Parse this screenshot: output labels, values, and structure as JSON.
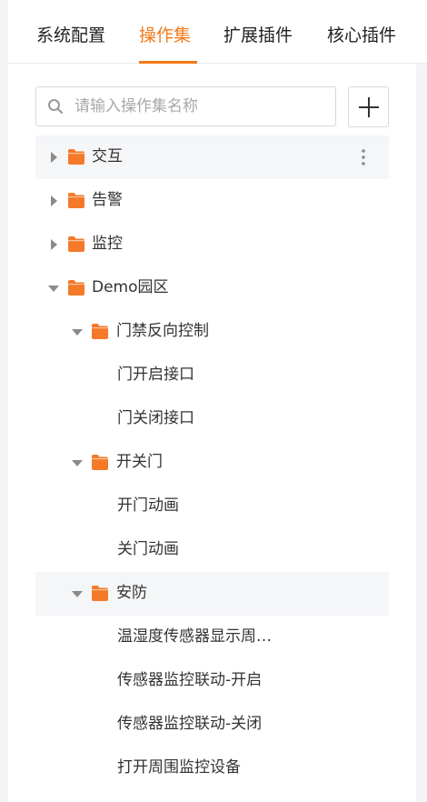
{
  "tabs": [
    {
      "label": "系统配置",
      "active": false
    },
    {
      "label": "操作集",
      "active": true
    },
    {
      "label": "扩展插件",
      "active": false
    },
    {
      "label": "核心插件",
      "active": false
    }
  ],
  "search": {
    "placeholder": "请输入操作集名称",
    "value": "",
    "icon": "search-icon"
  },
  "add_button": {
    "icon": "plus-icon"
  },
  "colors": {
    "accent": "#f27a1a",
    "folder": "#f47a2a",
    "highlight_row": "#f5f6f8"
  },
  "tree": [
    {
      "label": "交互",
      "type": "folder",
      "expanded": false,
      "level": 0,
      "highlighted": true,
      "has_more_menu": true
    },
    {
      "label": "告警",
      "type": "folder",
      "expanded": false,
      "level": 0
    },
    {
      "label": "监控",
      "type": "folder",
      "expanded": false,
      "level": 0
    },
    {
      "label": "Demo园区",
      "type": "folder",
      "expanded": true,
      "level": 0
    },
    {
      "label": "门禁反向控制",
      "type": "folder",
      "expanded": true,
      "level": 1
    },
    {
      "label": "门开启接口",
      "type": "item",
      "level": 2
    },
    {
      "label": "门关闭接口",
      "type": "item",
      "level": 2
    },
    {
      "label": "开关门",
      "type": "folder",
      "expanded": true,
      "level": 1
    },
    {
      "label": "开门动画",
      "type": "item",
      "level": 2
    },
    {
      "label": "关门动画",
      "type": "item",
      "level": 2
    },
    {
      "label": "安防",
      "type": "folder",
      "expanded": true,
      "level": 1,
      "highlighted": true
    },
    {
      "label": "温湿度传感器显示周…",
      "type": "item",
      "level": 2
    },
    {
      "label": "传感器监控联动-开启",
      "type": "item",
      "level": 2
    },
    {
      "label": "传感器监控联动-关闭",
      "type": "item",
      "level": 2
    },
    {
      "label": "打开周围监控设备",
      "type": "item",
      "level": 2
    }
  ]
}
